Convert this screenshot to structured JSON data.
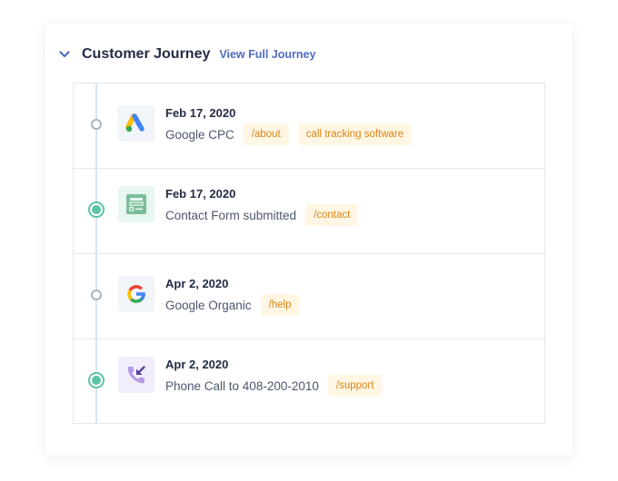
{
  "header": {
    "collapse_icon": "chevron-down-icon",
    "title": "Customer Journey",
    "link_label": "View Full Journey"
  },
  "colors": {
    "accent_link": "#4f6cbf",
    "active_dot": "#5cc3a6",
    "inactive_dot": "#a8b3bf",
    "tag_bg": "#fff6e3",
    "tag_text": "#d98517"
  },
  "events": [
    {
      "date": "Feb 17, 2020",
      "description": "Google CPC",
      "icon": "google-ads-icon",
      "status": "inactive",
      "tags": [
        "/about",
        "call tracking software"
      ]
    },
    {
      "date": "Feb 17, 2020",
      "description": "Contact Form submitted",
      "icon": "form-icon",
      "status": "active",
      "tags": [
        "/contact"
      ]
    },
    {
      "date": "Apr 2, 2020",
      "description": "Google Organic",
      "icon": "google-icon",
      "status": "inactive",
      "tags": [
        "/help"
      ]
    },
    {
      "date": "Apr 2, 2020",
      "description": "Phone Call to 408-200-2010",
      "icon": "incoming-call-icon",
      "status": "active",
      "tags": [
        "/support"
      ]
    }
  ]
}
